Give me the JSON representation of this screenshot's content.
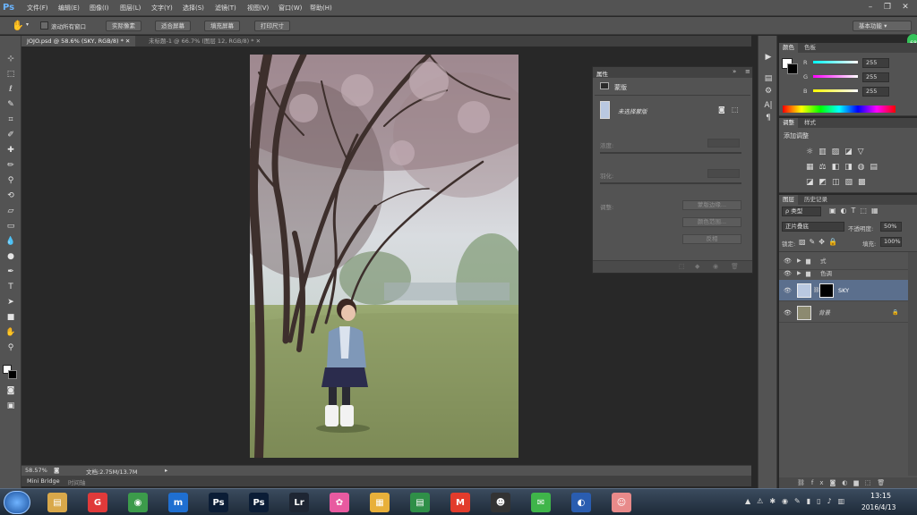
{
  "app": {
    "logo": "Ps"
  },
  "menu": [
    "文件(F)",
    "编辑(E)",
    "图像(I)",
    "图层(L)",
    "文字(Y)",
    "选择(S)",
    "滤镜(T)",
    "视图(V)",
    "窗口(W)",
    "帮助(H)"
  ],
  "options_bar": {
    "scroll_all_windows": "滚动所有窗口",
    "buttons": [
      "实际像素",
      "适合屏幕",
      "填充屏幕",
      "打印尺寸"
    ],
    "workspace": "基本功能"
  },
  "tabs": [
    {
      "label": "JOJO.psd @ 58.6% (SKY, RGB/8) *",
      "active": true
    },
    {
      "label": "未标题-1 @ 66.7% (图层 12, RGB/8) *",
      "active": false
    }
  ],
  "status": {
    "zoom": "58.57%",
    "doc": "文档:2.75M/13.7M"
  },
  "mini_bridge": {
    "tab1": "Mini Bridge",
    "tab2": "时间轴"
  },
  "properties_panel": {
    "title": "属性",
    "section": "蒙版",
    "mask_label": "未选择蒙版",
    "density_label": "浓度:",
    "feather_label": "羽化:",
    "adjust_label": "调整:",
    "btn_edge": "蒙版边缘...",
    "btn_color_range": "颜色范围...",
    "btn_invert": "反相"
  },
  "color_panel": {
    "tabs": [
      "颜色",
      "色板"
    ],
    "r_label": "R",
    "g_label": "G",
    "b_label": "B",
    "r": "255",
    "g": "255",
    "b": "255"
  },
  "adjust_panel": {
    "tabs": [
      "调整",
      "样式"
    ],
    "heading": "添加调整"
  },
  "layers_panel": {
    "tabs": [
      "图层",
      "历史记录"
    ],
    "kind": "ρ 类型",
    "blend_mode": "正片叠底",
    "opacity_label": "不透明度:",
    "opacity": "50%",
    "lock_label": "锁定:",
    "fill_label": "填充:",
    "fill": "100%",
    "layers": [
      {
        "name": "式",
        "type": "group"
      },
      {
        "name": "色调",
        "type": "group"
      },
      {
        "name": "SKY",
        "type": "masked",
        "selected": true
      },
      {
        "name": "背景",
        "type": "background"
      }
    ]
  },
  "taskbar": {
    "apps": [
      {
        "name": "explorer",
        "glyph": "▤",
        "color": "#d9a84a"
      },
      {
        "name": "app-red",
        "glyph": "G",
        "color": "#e03a3a"
      },
      {
        "name": "chrome",
        "glyph": "◉",
        "color": "#3c9b4b"
      },
      {
        "name": "app-blue",
        "glyph": "m",
        "color": "#1f6fd1"
      },
      {
        "name": "photoshop-1",
        "glyph": "Ps",
        "color": "#0b1d36"
      },
      {
        "name": "photoshop-2",
        "glyph": "Ps",
        "color": "#0b1d36"
      },
      {
        "name": "lightroom",
        "glyph": "Lr",
        "color": "#1e2633"
      },
      {
        "name": "app-flower",
        "glyph": "✿",
        "color": "#e85aa0"
      },
      {
        "name": "app-cube",
        "glyph": "▦",
        "color": "#e8b03a"
      },
      {
        "name": "app-sheet",
        "glyph": "▤",
        "color": "#2f8f48"
      },
      {
        "name": "app-m",
        "glyph": "M",
        "color": "#e23c2c"
      },
      {
        "name": "qq",
        "glyph": "☻",
        "color": "#333333"
      },
      {
        "name": "wechat",
        "glyph": "✉",
        "color": "#3fb54a"
      },
      {
        "name": "app-circle",
        "glyph": "◐",
        "color": "#2a5db0"
      },
      {
        "name": "app-ghost",
        "glyph": "☺",
        "color": "#e88a8a"
      }
    ],
    "time": "13:15",
    "date": "2016/4/13"
  }
}
